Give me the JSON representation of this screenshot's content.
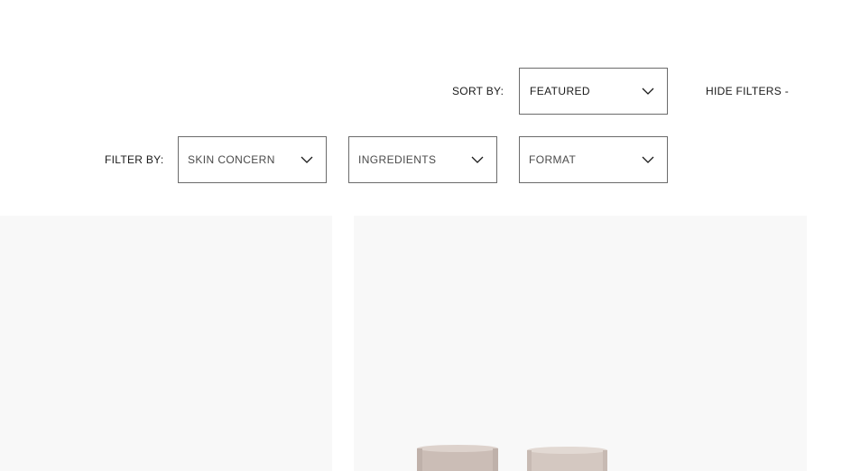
{
  "sort": {
    "label": "SORT BY:",
    "selected": "FEATURED"
  },
  "hide_filters": "HIDE FILTERS -",
  "filters": {
    "label": "FILTER BY:",
    "items": [
      {
        "label": "SKIN CONCERN"
      },
      {
        "label": "INGREDIENTS"
      },
      {
        "label": "FORMAT"
      }
    ]
  },
  "icons": {
    "chevron": "chevron-down-icon"
  },
  "colors": {
    "card_bg": "#f8f8f8",
    "jar": "#cfc2bb",
    "border": "#6b6b6b"
  }
}
